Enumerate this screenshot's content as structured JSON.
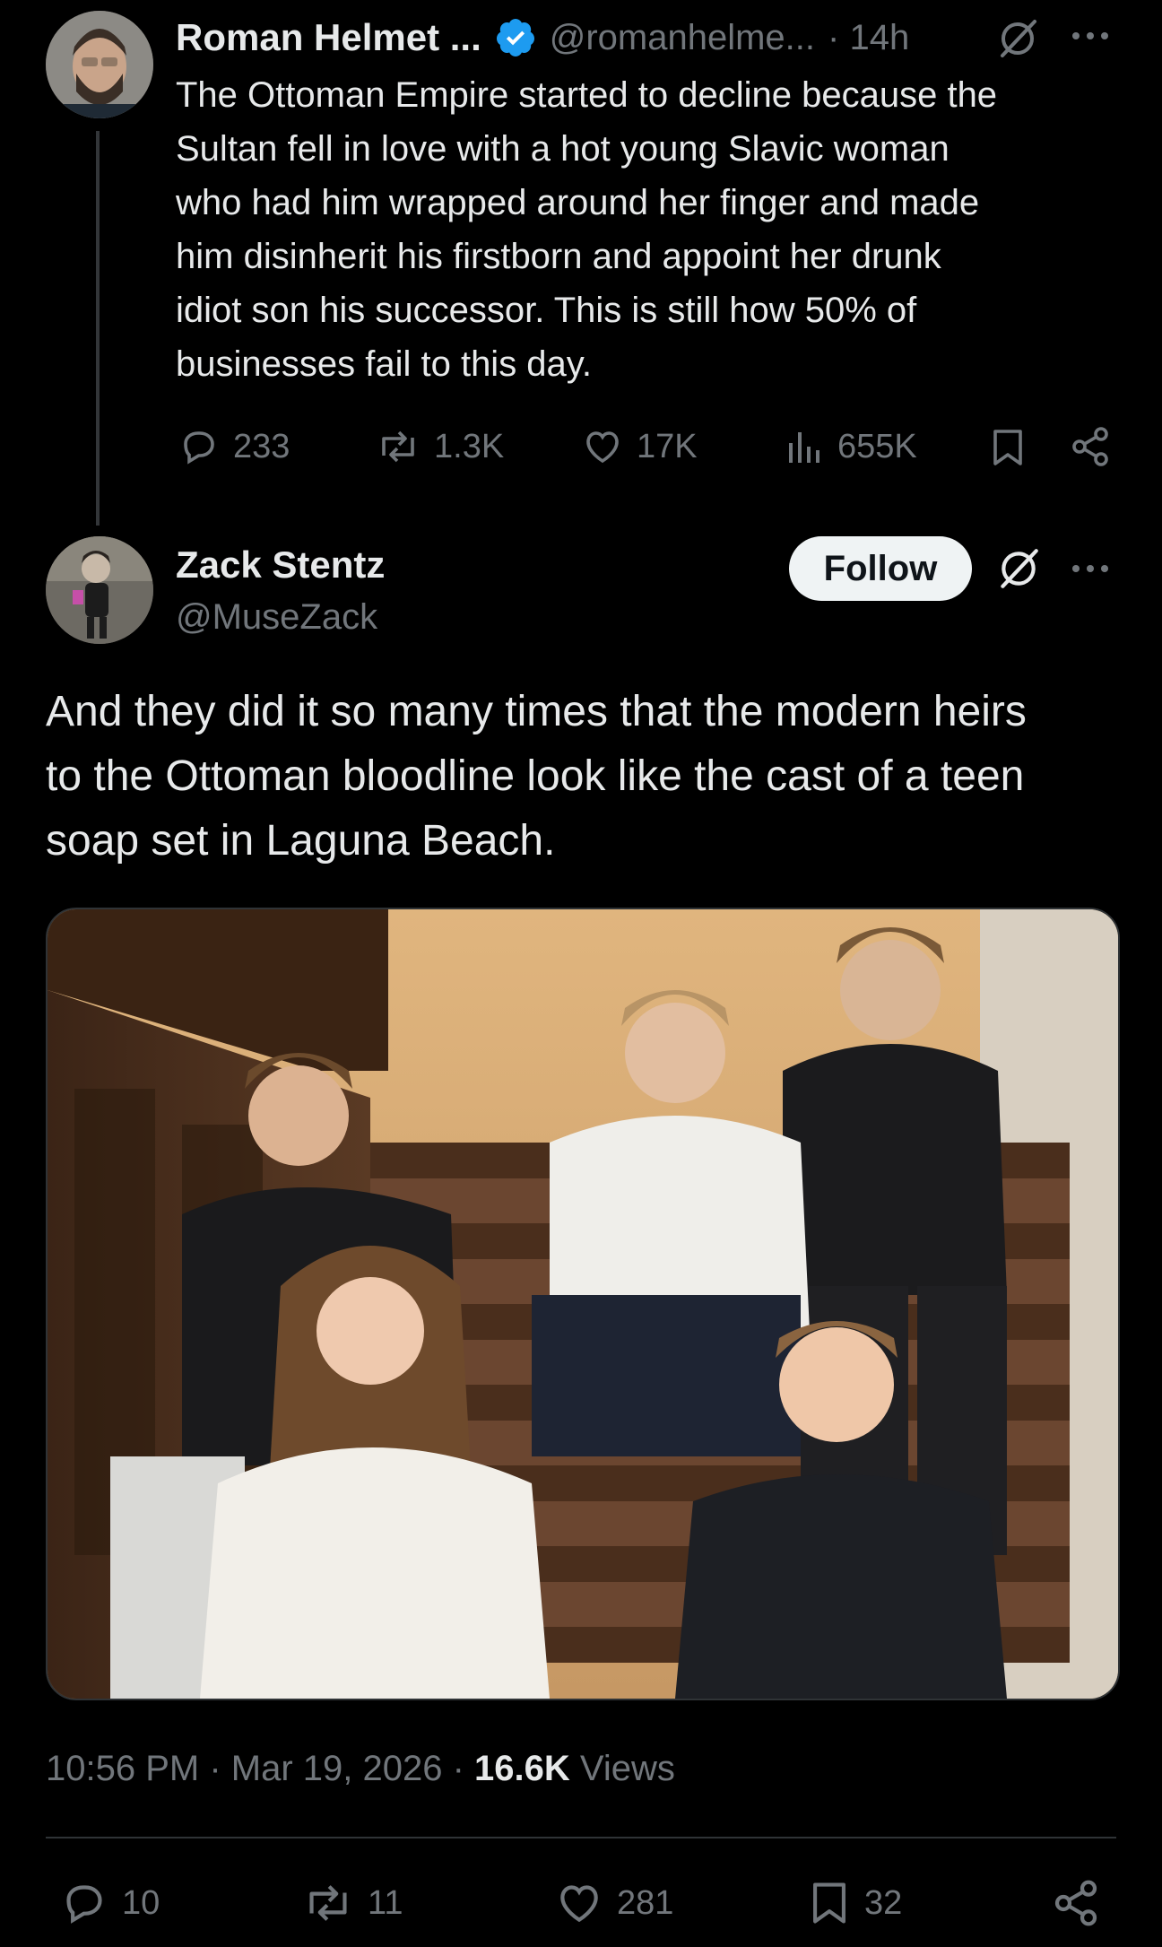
{
  "parent_post": {
    "author_name": "Roman Helmet ...",
    "handle": "@romanhelme...",
    "time": "· 14h",
    "text_lines": [
      "The Ottoman Empire started to decline because the",
      "Sultan fell in love with a hot young Slavic woman",
      "who had him wrapped around her finger and made",
      "him disinherit his firstborn and appoint her drunk",
      "idiot son his successor. This is still how 50% of",
      "businesses fail to this day."
    ],
    "replies": "233",
    "reposts": "1.3K",
    "likes": "17K",
    "views": "655K"
  },
  "main_post": {
    "author_name": "Zack Stentz",
    "handle": "@MuseZack",
    "follow_label": "Follow",
    "text_lines": [
      "And they did it so many times that the modern heirs",
      "to the Ottoman bloodline look like the cast of a teen",
      "soap set in Laguna Beach."
    ],
    "timestamp": "10:56 PM · Mar 19, 2026 · ",
    "views_count": "16.6K",
    "views_label": " Views",
    "replies": "10",
    "reposts": "11",
    "likes": "281",
    "bookmarks": "32"
  },
  "icons": {
    "verified": "verified-badge-icon",
    "grok": "grok-icon",
    "more": "more-icon",
    "reply": "reply-icon",
    "repost": "repost-icon",
    "like": "like-icon",
    "views": "views-icon",
    "bookmark": "bookmark-icon",
    "share": "share-icon"
  },
  "colors": {
    "background": "#000000",
    "text": "#e7e9ea",
    "muted": "#71767b",
    "verified": "#1d9bf0",
    "follow_bg": "#eff3f4"
  }
}
